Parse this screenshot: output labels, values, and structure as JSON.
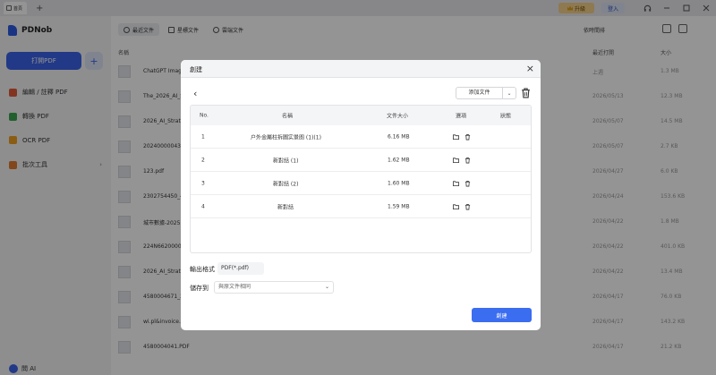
{
  "titlebar": {
    "home_tab": "首頁",
    "new_tab": "+",
    "upgrade": "升級",
    "login": "登入"
  },
  "sidebar": {
    "app_name": "PDNob",
    "open_pdf": "打開PDF",
    "add": "+",
    "items": [
      {
        "label": "編輯 / 註釋 PDF",
        "icon": "edit-icon",
        "color": "#e25b3a"
      },
      {
        "label": "轉換 PDF",
        "icon": "convert-icon",
        "color": "#3aa54f"
      },
      {
        "label": "OCR PDF",
        "icon": "ocr-icon",
        "color": "#f0a020"
      },
      {
        "label": "批次工具",
        "icon": "batch-icon",
        "color": "#e07a30"
      }
    ],
    "ai_label": "問 AI"
  },
  "main": {
    "tabs": [
      {
        "label": "最近文件"
      },
      {
        "label": "星標文件"
      },
      {
        "label": "雲端文件"
      }
    ],
    "sort_label": "依時間排",
    "columns": {
      "name": "名稱",
      "opened": "最近打開",
      "size": "大小"
    },
    "rows": [
      {
        "name": "ChatGPT Image...",
        "date": "上週",
        "size": "1.3 MB"
      },
      {
        "name": "The_2026_AI_St...",
        "date": "2026/05/13",
        "size": "12.3 MB"
      },
      {
        "name": "2026_AI_Strate...",
        "date": "2026/05/07",
        "size": "14.5 MB"
      },
      {
        "name": "2024000004381...",
        "date": "2026/05/07",
        "size": "2.7 KB"
      },
      {
        "name": "123.pdf",
        "date": "2026/04/27",
        "size": "6.0 KB"
      },
      {
        "name": "2302754450_4...",
        "date": "2026/04/24",
        "size": "153.6 KB"
      },
      {
        "name": "城市數據-2025...",
        "date": "2026/04/22",
        "size": "1.8 MB"
      },
      {
        "name": "224N66200006...",
        "date": "2026/04/22",
        "size": "401.0 KB"
      },
      {
        "name": "2026_AI_Strate...",
        "date": "2026/04/22",
        "size": "13.4 MB"
      },
      {
        "name": "4580004671_2...",
        "date": "2026/04/17",
        "size": "76.0 KB"
      },
      {
        "name": "wi.pl&invoice...",
        "date": "2026/04/17",
        "size": "143.2 KB"
      },
      {
        "name": "4580004041.PDF",
        "date": "2026/04/17",
        "size": "21.2 KB"
      }
    ]
  },
  "dialog": {
    "title": "創建",
    "close": "×",
    "back": "‹",
    "add_file": "添加文件",
    "headers": {
      "no": "No.",
      "name": "名稱",
      "size": "文件大小",
      "ops": "選項",
      "status": "狀態"
    },
    "files": [
      {
        "no": "1",
        "name": "户外金屬柱拆圖实景图 (1)(1)",
        "size": "6.16 MB"
      },
      {
        "no": "2",
        "name": "新對話 (1)",
        "size": "1.62 MB"
      },
      {
        "no": "3",
        "name": "新對話 (2)",
        "size": "1.60 MB"
      },
      {
        "no": "4",
        "name": "新對話",
        "size": "1.59 MB"
      }
    ],
    "output_format_label": "輸出格式",
    "output_format_value": "PDF(*.pdf)",
    "save_to_label": "儲存到",
    "save_to_value": "與原文件相同",
    "create": "創建"
  }
}
